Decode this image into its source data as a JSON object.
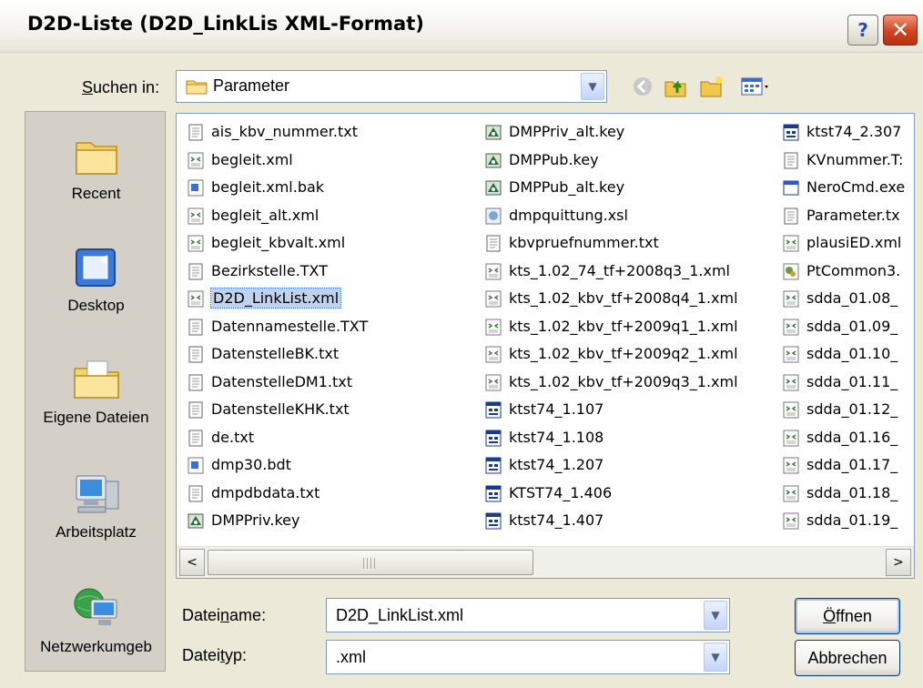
{
  "window": {
    "title": "D2D-Liste (D2D_LinkLis XML-Format)",
    "help_label": "?",
    "close_label": "✕"
  },
  "lookin": {
    "label_prefix": "S",
    "label_rest": "uchen in:",
    "value": "Parameter"
  },
  "toolbar": {
    "icons": [
      "back-icon",
      "up-folder-icon",
      "new-folder-icon",
      "views-menu-icon"
    ]
  },
  "places": [
    {
      "label": "Recent",
      "icon": "recent-folder-icon"
    },
    {
      "label": "Desktop",
      "icon": "desktop-icon"
    },
    {
      "label": "Eigene Dateien",
      "icon": "my-documents-icon"
    },
    {
      "label": "Arbeitsplatz",
      "icon": "my-computer-icon"
    },
    {
      "label": "Netzwerkumgeb",
      "icon": "network-icon"
    }
  ],
  "files": {
    "col1": [
      {
        "name": "ais_kbv_nummer.txt",
        "type": "txt"
      },
      {
        "name": "begleit.xml",
        "type": "xml"
      },
      {
        "name": "begleit.xml.bak",
        "type": "bak"
      },
      {
        "name": "begleit_alt.xml",
        "type": "xml"
      },
      {
        "name": "begleit_kbvalt.xml",
        "type": "xml"
      },
      {
        "name": "Bezirkstelle.TXT",
        "type": "txt"
      },
      {
        "name": "D2D_LinkList.xml",
        "type": "xml",
        "selected": true
      },
      {
        "name": "Datennamestelle.TXT",
        "type": "txt"
      },
      {
        "name": "DatenstelleBK.txt",
        "type": "txt"
      },
      {
        "name": "DatenstelleDM1.txt",
        "type": "txt"
      },
      {
        "name": "DatenstelleKHK.txt",
        "type": "txt"
      },
      {
        "name": "de.txt",
        "type": "txt"
      },
      {
        "name": "dmp30.bdt",
        "type": "bak"
      },
      {
        "name": "dmpdbdata.txt",
        "type": "txt"
      },
      {
        "name": "DMPPriv.key",
        "type": "key"
      }
    ],
    "col2": [
      {
        "name": "DMPPriv_alt.key",
        "type": "key"
      },
      {
        "name": "DMPPub.key",
        "type": "key"
      },
      {
        "name": "DMPPub_alt.key",
        "type": "key"
      },
      {
        "name": "dmpquittung.xsl",
        "type": "xsl"
      },
      {
        "name": "kbvpruefnummer.txt",
        "type": "txt"
      },
      {
        "name": "kts_1.02_74_tf+2008q3_1.xml",
        "type": "xml"
      },
      {
        "name": "kts_1.02_kbv_tf+2008q4_1.xml",
        "type": "xml"
      },
      {
        "name": "kts_1.02_kbv_tf+2009q1_1.xml",
        "type": "xml"
      },
      {
        "name": "kts_1.02_kbv_tf+2009q2_1.xml",
        "type": "xml"
      },
      {
        "name": "kts_1.02_kbv_tf+2009q3_1.xml",
        "type": "xml"
      },
      {
        "name": "ktst74_1.107",
        "type": "bin"
      },
      {
        "name": "ktst74_1.108",
        "type": "bin"
      },
      {
        "name": "ktst74_1.207",
        "type": "bin"
      },
      {
        "name": "KTST74_1.406",
        "type": "bin"
      },
      {
        "name": "ktst74_1.407",
        "type": "bin"
      }
    ],
    "col3": [
      {
        "name": "ktst74_2.307",
        "type": "bin"
      },
      {
        "name": "KVnummer.T:",
        "type": "txt"
      },
      {
        "name": "NeroCmd.exe",
        "type": "exe"
      },
      {
        "name": "Parameter.tx",
        "type": "txt"
      },
      {
        "name": "plausiED.xml",
        "type": "xml"
      },
      {
        "name": "PtCommon3.",
        "type": "dll"
      },
      {
        "name": "sdda_01.08_",
        "type": "xml"
      },
      {
        "name": "sdda_01.09_",
        "type": "xml"
      },
      {
        "name": "sdda_01.10_",
        "type": "xml"
      },
      {
        "name": "sdda_01.11_",
        "type": "xml"
      },
      {
        "name": "sdda_01.12_",
        "type": "xml"
      },
      {
        "name": "sdda_01.16_",
        "type": "xml"
      },
      {
        "name": "sdda_01.17_",
        "type": "xml"
      },
      {
        "name": "sdda_01.18_",
        "type": "xml"
      },
      {
        "name": "sdda_01.19_",
        "type": "xml"
      }
    ]
  },
  "scrollbar": {
    "left_arrow": "<",
    "right_arrow": ">"
  },
  "filename": {
    "label_pre": "Datei",
    "label_u": "n",
    "label_post": "ame:",
    "value": "D2D_LinkList.xml"
  },
  "filetype": {
    "label_pre": "Datei",
    "label_u": "t",
    "label_post": "yp:",
    "value": ".xml"
  },
  "buttons": {
    "open_u": "Ö",
    "open_rest": "ffnen",
    "cancel": "Abbrechen"
  }
}
